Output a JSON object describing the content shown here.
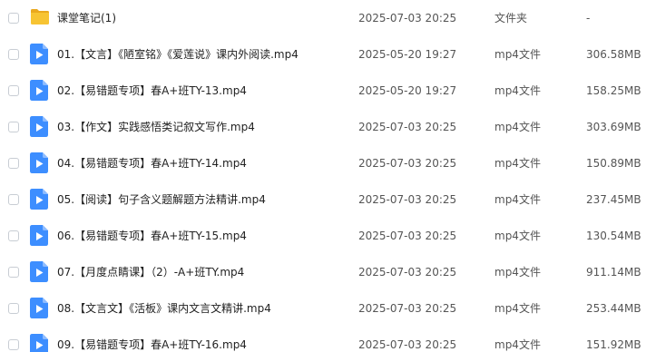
{
  "rows": [
    {
      "name": "课堂笔记(1)",
      "modified": "2025-07-03 20:25",
      "type": "文件夹",
      "size": "-",
      "icon": "folder-icon"
    },
    {
      "name": "01.【文言】《陋室铭》《爱莲说》课内外阅读.mp4",
      "modified": "2025-05-20 19:27",
      "type": "mp4文件",
      "size": "306.58MB",
      "icon": "video-file-icon"
    },
    {
      "name": "02.【易错题专项】春A+班TY-13.mp4",
      "modified": "2025-05-20 19:27",
      "type": "mp4文件",
      "size": "158.25MB",
      "icon": "video-file-icon"
    },
    {
      "name": "03.【作文】实践感悟类记叙文写作.mp4",
      "modified": "2025-07-03 20:25",
      "type": "mp4文件",
      "size": "303.69MB",
      "icon": "video-file-icon"
    },
    {
      "name": "04.【易错题专项】春A+班TY-14.mp4",
      "modified": "2025-07-03 20:25",
      "type": "mp4文件",
      "size": "150.89MB",
      "icon": "video-file-icon"
    },
    {
      "name": "05.【阅读】句子含义题解题方法精讲.mp4",
      "modified": "2025-07-03 20:25",
      "type": "mp4文件",
      "size": "237.45MB",
      "icon": "video-file-icon"
    },
    {
      "name": "06.【易错题专项】春A+班TY-15.mp4",
      "modified": "2025-07-03 20:25",
      "type": "mp4文件",
      "size": "130.54MB",
      "icon": "video-file-icon"
    },
    {
      "name": "07.【月度点睛课】（2）-A+班TY.mp4",
      "modified": "2025-07-03 20:25",
      "type": "mp4文件",
      "size": "911.14MB",
      "icon": "video-file-icon"
    },
    {
      "name": "08.【文言文】《活板》课内文言文精讲.mp4",
      "modified": "2025-07-03 20:25",
      "type": "mp4文件",
      "size": "253.44MB",
      "icon": "video-file-icon"
    },
    {
      "name": "09.【易错题专项】春A+班TY-16.mp4",
      "modified": "2025-07-03 20:25",
      "type": "mp4文件",
      "size": "151.92MB",
      "icon": "video-file-icon"
    }
  ],
  "colors": {
    "folder": "#f7c433",
    "folder_tab": "#eaa91f",
    "video": "#3d8eff",
    "video_fold": "#8dbcff"
  }
}
